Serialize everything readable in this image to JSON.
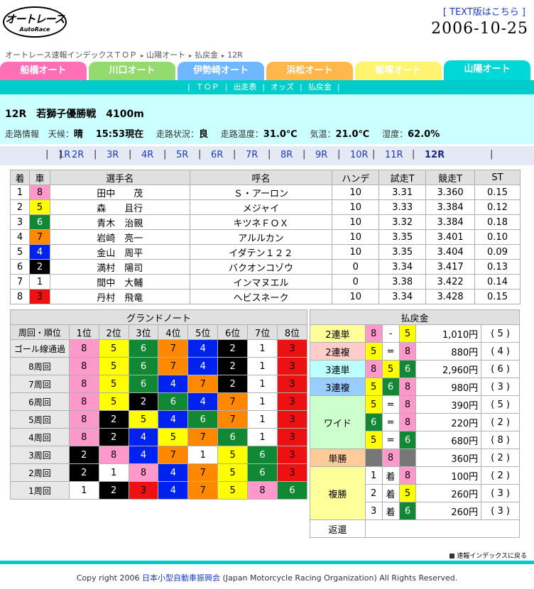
{
  "header": {
    "logo_main": "オートレース",
    "logo_sub": "AutoRace",
    "text_link": "[ TEXT版はこちら ]",
    "date": "2006-10-25"
  },
  "breadcrumb": [
    "オートレース速報インデックスＴＯＰ",
    "山陽オート",
    "払戻金",
    "12R"
  ],
  "tabs": [
    {
      "label": "船橋オート",
      "color": "#ff3399"
    },
    {
      "label": "川口オート",
      "color": "#66cc33"
    },
    {
      "label": "伊勢崎オート",
      "color": "#3399ff"
    },
    {
      "label": "浜松オート",
      "color": "#ff9900"
    },
    {
      "label": "飯塚オート",
      "color": "#ffee33"
    },
    {
      "label": "山陽オート",
      "color": "#00d8d8",
      "active": true
    }
  ],
  "subnav": [
    "ＴＯＰ",
    "出走表",
    "オッズ",
    "払戻金"
  ],
  "race": {
    "title": "12R　若獅子優勝戦　4100m"
  },
  "weather": {
    "info_label": "走路情報",
    "tenko_label": "天候：",
    "tenko": "晴",
    "time": "15:53現在",
    "road_label": "走路状況：",
    "road": "良",
    "roadtemp_label": "走路温度：",
    "roadtemp": "31.0℃",
    "temp_label": "気温：",
    "temp": "21.0℃",
    "hum_label": "湿度：",
    "hum": "62.0%"
  },
  "race_links": [
    "1R",
    "2R",
    "3R",
    "4R",
    "5R",
    "6R",
    "7R",
    "8R",
    "9R",
    "10R",
    "11R",
    "12R"
  ],
  "results": {
    "headers": [
      "着",
      "車",
      "選手名",
      "呼名",
      "ハンデ",
      "試走T",
      "競走T",
      "ST"
    ],
    "rows": [
      [
        "1",
        "8",
        "田中　　茂",
        "Ｓ・アーロン",
        "10",
        "3.31",
        "3.360",
        "0.15"
      ],
      [
        "2",
        "5",
        "森　　且行",
        "メジャイ",
        "10",
        "3.33",
        "3.384",
        "0.12"
      ],
      [
        "3",
        "6",
        "青木　治親",
        "キツネＦＯＸ",
        "10",
        "3.32",
        "3.384",
        "0.18"
      ],
      [
        "4",
        "7",
        "岩崎　亮一",
        "アルルカン",
        "10",
        "3.35",
        "3.401",
        "0.10"
      ],
      [
        "5",
        "4",
        "金山　周平",
        "イダテン１２２",
        "10",
        "3.35",
        "3.404",
        "0.09"
      ],
      [
        "6",
        "2",
        "満村　陽司",
        "バクオンコゾウ",
        "0",
        "3.34",
        "3.417",
        "0.13"
      ],
      [
        "7",
        "1",
        "間中　大輔",
        "インマヌエル",
        "0",
        "3.38",
        "3.422",
        "0.14"
      ],
      [
        "8",
        "3",
        "丹村　飛竜",
        "ヘビスネーク",
        "10",
        "3.34",
        "3.428",
        "0.15"
      ]
    ]
  },
  "grand_note": {
    "title": "グランドノート",
    "headers": [
      "周回・順位",
      "1位",
      "2位",
      "3位",
      "4位",
      "5位",
      "6位",
      "7位",
      "8位"
    ],
    "rows": [
      {
        "label": "ゴール線通過",
        "order": [
          "8",
          "5",
          "6",
          "7",
          "4",
          "2",
          "1",
          "3"
        ]
      },
      {
        "label": "8周回",
        "order": [
          "8",
          "5",
          "6",
          "7",
          "4",
          "2",
          "1",
          "3"
        ]
      },
      {
        "label": "7周回",
        "order": [
          "8",
          "5",
          "6",
          "4",
          "7",
          "2",
          "1",
          "3"
        ]
      },
      {
        "label": "6周回",
        "order": [
          "8",
          "5",
          "2",
          "6",
          "4",
          "7",
          "1",
          "3"
        ]
      },
      {
        "label": "5周回",
        "order": [
          "8",
          "2",
          "5",
          "4",
          "6",
          "7",
          "1",
          "3"
        ]
      },
      {
        "label": "4周回",
        "order": [
          "8",
          "2",
          "4",
          "5",
          "7",
          "6",
          "1",
          "3"
        ]
      },
      {
        "label": "3周回",
        "order": [
          "2",
          "8",
          "4",
          "7",
          "1",
          "5",
          "6",
          "3"
        ]
      },
      {
        "label": "2周回",
        "order": [
          "2",
          "1",
          "8",
          "4",
          "7",
          "5",
          "6",
          "3"
        ]
      },
      {
        "label": "1周回",
        "order": [
          "1",
          "2",
          "3",
          "4",
          "7",
          "5",
          "8",
          "6"
        ]
      }
    ]
  },
  "payout": {
    "title": "払戻金",
    "nirentan_label": "2連単",
    "nirentan": {
      "a": "8",
      "sep": "-",
      "b": "5",
      "amt": "1,010円",
      "pop": "( 5 )"
    },
    "nirenpuku_label": "2連複",
    "nirenpuku": {
      "a": "5",
      "sep": "=",
      "b": "8",
      "amt": "880円",
      "pop": "( 4 )"
    },
    "sanrentan_label": "3連単",
    "sanrentan": {
      "a": "8",
      "b": "5",
      "c": "6",
      "amt": "2,960円",
      "pop": "( 6 )"
    },
    "sanrenpuku_label": "3連複",
    "sanrenpuku": {
      "a": "5",
      "b": "6",
      "c": "8",
      "amt": "980円",
      "pop": "( 3 )"
    },
    "wide_label": "ワイド",
    "wide": [
      {
        "a": "5",
        "sep": "=",
        "b": "8",
        "amt": "390円",
        "pop": "( 5 )"
      },
      {
        "a": "6",
        "sep": "=",
        "b": "8",
        "amt": "220円",
        "pop": "( 2 )"
      },
      {
        "a": "5",
        "sep": "=",
        "b": "6",
        "amt": "680円",
        "pop": "( 8 )"
      }
    ],
    "tansho_label": "単勝",
    "tansho": {
      "car": "8",
      "amt": "360円",
      "pop": "( 2 )"
    },
    "fukusho_label": "複勝",
    "fukusho": [
      {
        "rank": "1",
        "chaku": "着",
        "car": "8",
        "amt": "100円",
        "pop": "( 2 )"
      },
      {
        "rank": "2",
        "chaku": "着",
        "car": "5",
        "amt": "260円",
        "pop": "( 3 )"
      },
      {
        "rank": "3",
        "chaku": "着",
        "car": "6",
        "amt": "260円",
        "pop": "( 3 )"
      }
    ],
    "henkan_label": "返還",
    "henkan": ""
  },
  "footer": {
    "back_link": "速報インデックスに戻る",
    "copyright_pre": "Copy right 2006",
    "org": "日本小型自動車振興会",
    "copyright_post": "(Japan Motorcycle Racing Organization)  All Rights Reserved."
  }
}
